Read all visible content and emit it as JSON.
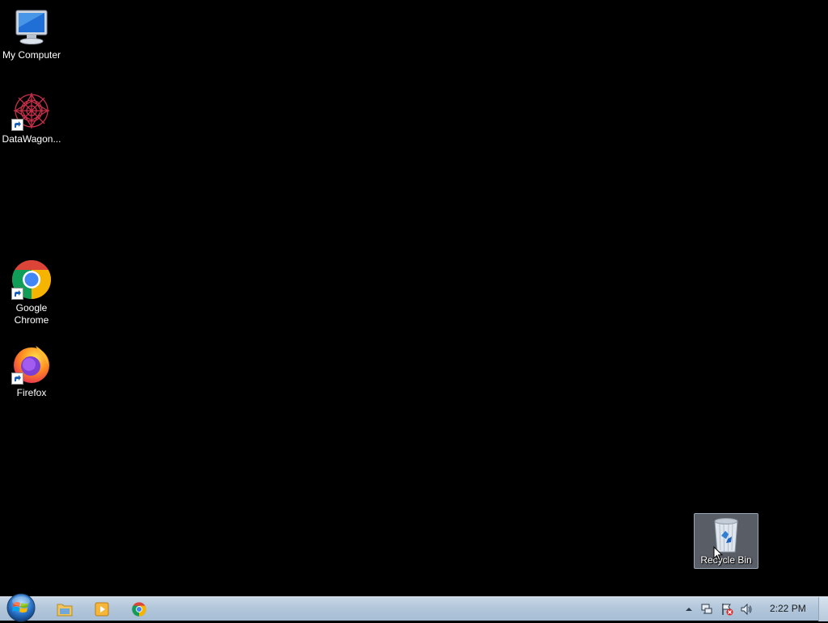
{
  "desktop": {
    "icons": [
      {
        "label": "My Computer"
      },
      {
        "label": "DataWagon..."
      },
      {
        "label": "Google\nChrome"
      },
      {
        "label": "Firefox"
      },
      {
        "label": "Recycle Bin"
      }
    ]
  },
  "taskbar": {
    "pinned": [
      "file-explorer-icon",
      "media-player-icon",
      "chrome-icon"
    ],
    "clock": "2:22 PM"
  },
  "colors": {
    "desktop_bg": "#000000",
    "taskbar_bg": "#b3c7db",
    "selection": "#9aa7b6"
  }
}
